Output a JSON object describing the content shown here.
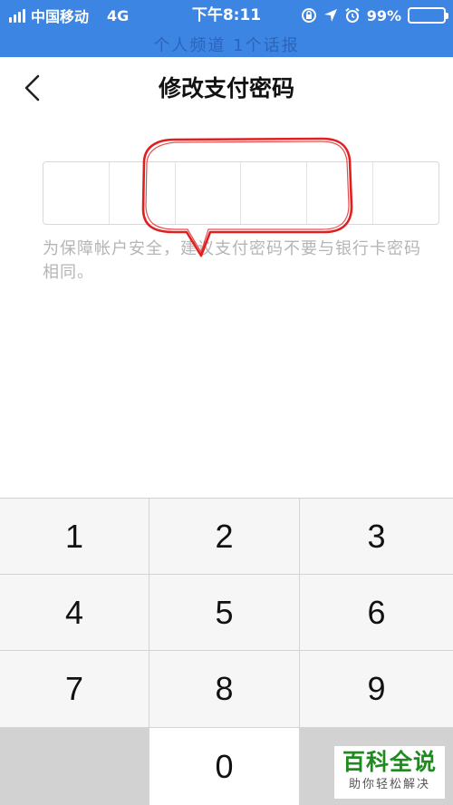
{
  "status_bar": {
    "carrier": "中国移动",
    "network": "4G",
    "time": "下午8:11",
    "battery_percent": "99%",
    "battery_level": 0.99,
    "icons": [
      "signal-icon",
      "rotation-lock-icon",
      "location-icon",
      "alarm-icon",
      "battery-icon"
    ]
  },
  "header_ghost_text": "个人频道  1个话报",
  "nav": {
    "back_icon": "chevron-left-icon",
    "title": "修改支付密码"
  },
  "password": {
    "length": 6
  },
  "hint": "为保障帐户安全，建议支付密码不要与银行卡密码相同。",
  "keypad": {
    "keys": [
      "1",
      "2",
      "3",
      "4",
      "5",
      "6",
      "7",
      "8",
      "9",
      "",
      "0",
      ""
    ]
  },
  "watermark": {
    "main": "百科全说",
    "sub": "助你轻松解决"
  },
  "colors": {
    "status_bar": "#3d85e2",
    "annotation": "#e02020",
    "watermark": "#1f8a1f"
  }
}
